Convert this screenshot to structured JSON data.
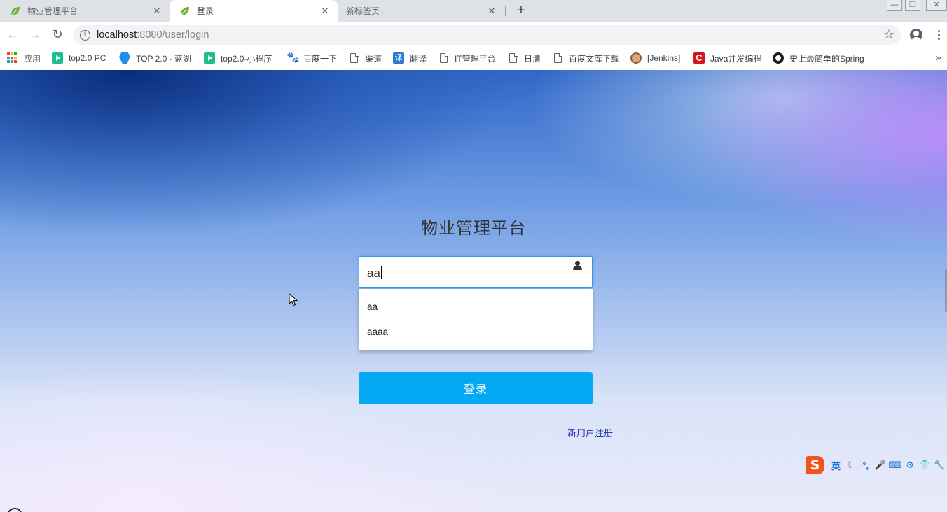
{
  "tabs": [
    {
      "title": "物业管理平台",
      "close": "✕"
    },
    {
      "title": "登录",
      "close": "✕"
    },
    {
      "title": "新标签页",
      "close": "✕"
    }
  ],
  "new_tab_symbol": "+",
  "window_controls": {
    "minimize": "—",
    "restore": "❐",
    "close": "✕"
  },
  "toolbar": {
    "back": "←",
    "forward": "→",
    "reload": "↻",
    "info_symbol": "i",
    "url_host": "localhost",
    "url_rest": ":8080/user/login",
    "star": "☆"
  },
  "bookmarks": [
    {
      "label": "应用",
      "icon": "apps-grid-icon"
    },
    {
      "label": "top2.0 PC",
      "icon": "play-icon"
    },
    {
      "label": "TOP 2.0 - 蓝湖",
      "icon": "lanhu-icon"
    },
    {
      "label": "top2.0-小程序",
      "icon": "play-icon"
    },
    {
      "label": "百度一下",
      "icon": "baidu-paw-icon"
    },
    {
      "label": "渠道",
      "icon": "document-icon"
    },
    {
      "label": "翻译",
      "icon": "translate-icon"
    },
    {
      "label": "IT管理平台",
      "icon": "document-icon"
    },
    {
      "label": "日清",
      "icon": "document-icon"
    },
    {
      "label": "百度文库下载",
      "icon": "document-icon"
    },
    {
      "label": "[Jenkins]",
      "icon": "jenkins-icon"
    },
    {
      "label": "Java并发编程",
      "icon": "csdn-icon"
    },
    {
      "label": "史上最简单的Spring",
      "icon": "github-icon"
    }
  ],
  "bookmark_icon_glyphs": {
    "paw": "🐾",
    "translate": "译",
    "csdn": "C"
  },
  "bookmarks_more": "»",
  "login": {
    "title": "物业管理平台",
    "username_value": "aa",
    "autocomplete": [
      "aa",
      "aaaa"
    ],
    "submit_label": "登录",
    "register_label": "新用户注册"
  },
  "ime": {
    "logo": "S",
    "mode": "英",
    "items": [
      "☾",
      "°,",
      "🎤",
      "⌨",
      "⚙",
      "👕",
      "🔧"
    ]
  },
  "colors": {
    "primary_button": "#03a9f4",
    "link": "#1a2fa8",
    "input_focus_border": "#2b9be0"
  }
}
